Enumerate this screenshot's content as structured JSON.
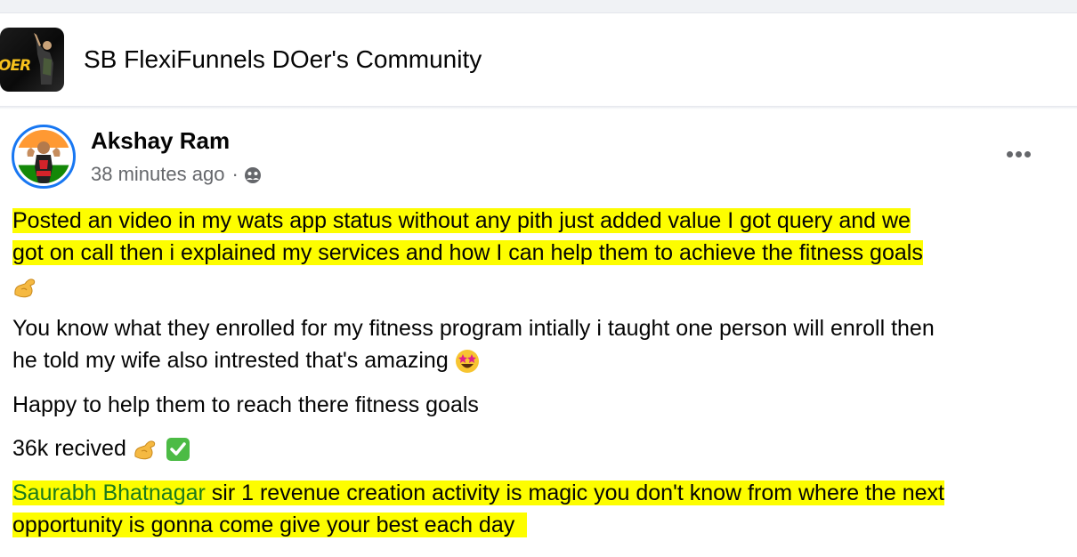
{
  "group": {
    "title": "SB FlexiFunnels DOer's Community",
    "avatar_text": "OER"
  },
  "post": {
    "author": "Akshay Ram",
    "time": "38 minutes ago",
    "separator": "·",
    "audience_icon": "group-icon",
    "more_icon": "more-options-icon",
    "paragraph1": {
      "line1": "Posted an video in my wats app status without any pith just added value I got query and we ",
      "line2": "got on call then i explained my services and how I can help them to achieve the fitness goals ",
      "emoji": "flexed-biceps"
    },
    "paragraph2": {
      "line1": "You know what they enrolled for my fitness program intially i taught one person will enroll then",
      "line2": "he told my wife also intrested that's amazing",
      "emoji": "star-struck"
    },
    "paragraph3": "Happy to help them to reach there fitness goals",
    "paragraph4": {
      "text": "36k recived",
      "emojis": [
        "flexed-biceps",
        "check-mark-button"
      ]
    },
    "paragraph5": {
      "mention": "Saurabh Bhatnagar",
      "line1_rest": " sir 1 revenue creation activity is magic you don't know from where the next",
      "line2": "opportunity is gonna come give your best each day  "
    }
  },
  "colors": {
    "highlight": "#fdfd00",
    "mention": "#1c7a1c",
    "meta": "#65676b",
    "avatar_ring": "#1877f2"
  }
}
